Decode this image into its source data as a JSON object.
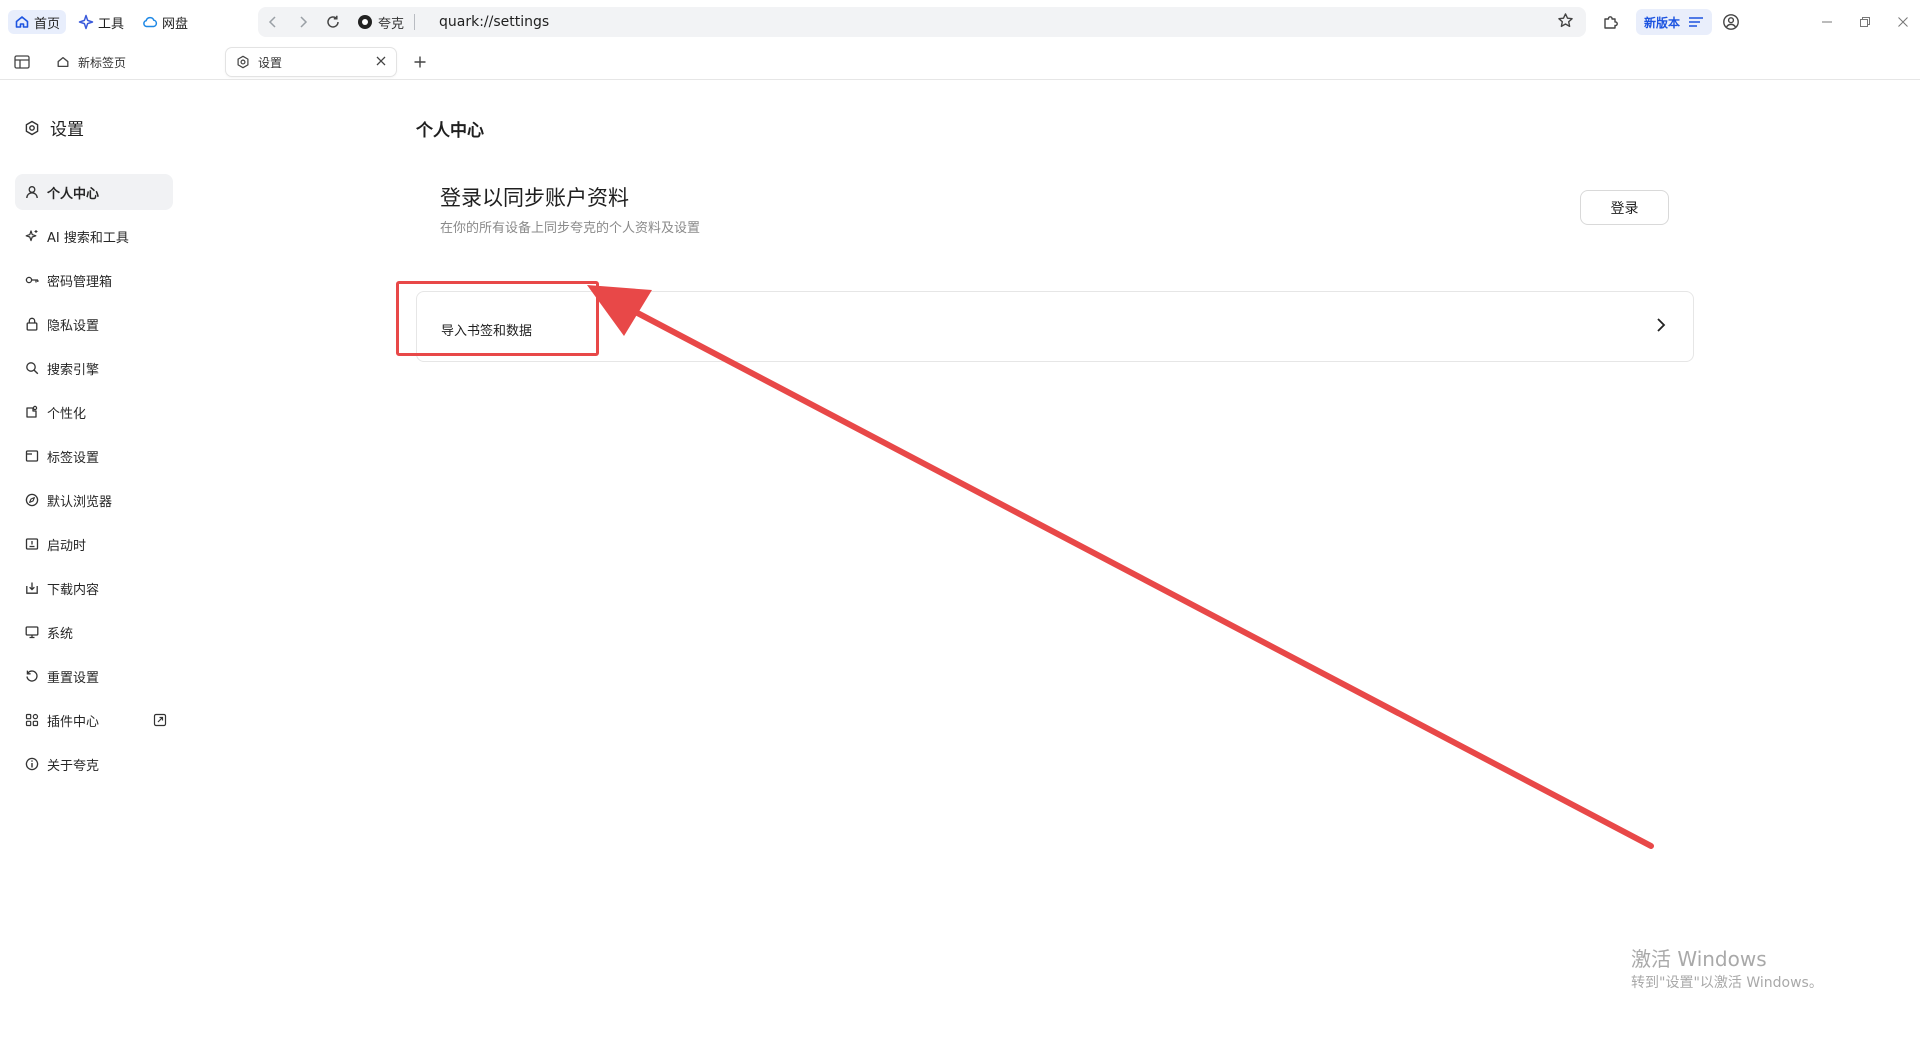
{
  "topbar": {
    "nav": [
      {
        "label": "首页",
        "icon": "home-icon"
      },
      {
        "label": "工具",
        "icon": "sparkle-icon"
      },
      {
        "label": "网盘",
        "icon": "cloud-icon"
      }
    ],
    "address": {
      "site_label": "夸克",
      "url": "quark://settings"
    },
    "new_version_label": "新版本"
  },
  "tabs": [
    {
      "label": "新标签页",
      "icon": "home-icon"
    },
    {
      "label": "设置",
      "icon": "gear-icon"
    }
  ],
  "sidebar": {
    "title": "设置",
    "items": [
      {
        "label": "个人中心",
        "icon": "user-icon",
        "active": true
      },
      {
        "label": "AI 搜索和工具",
        "icon": "sparkle-icon"
      },
      {
        "label": "密码管理箱",
        "icon": "key-icon"
      },
      {
        "label": "隐私设置",
        "icon": "lock-icon"
      },
      {
        "label": "搜索引擎",
        "icon": "search-icon"
      },
      {
        "label": "个性化",
        "icon": "palette-icon"
      },
      {
        "label": "标签设置",
        "icon": "tab-icon"
      },
      {
        "label": "默认浏览器",
        "icon": "compass-icon"
      },
      {
        "label": "启动时",
        "icon": "startup-icon"
      },
      {
        "label": "下载内容",
        "icon": "download-icon"
      },
      {
        "label": "系统",
        "icon": "monitor-icon"
      },
      {
        "label": "重置设置",
        "icon": "reset-icon"
      },
      {
        "label": "插件中心",
        "icon": "puzzle-grid-icon",
        "external": true
      },
      {
        "label": "关于夸克",
        "icon": "info-icon"
      }
    ]
  },
  "main": {
    "title": "个人中心",
    "login": {
      "title": "登录以同步账户资料",
      "subtitle": "在你的所有设备上同步夸克的个人资料及设置",
      "button": "登录"
    },
    "import": {
      "label": "导入书签和数据"
    }
  },
  "annotation": {
    "color": "#e84848"
  },
  "watermark": {
    "line1": "激活 Windows",
    "line2": "转到\"设置\"以激活 Windows。"
  }
}
